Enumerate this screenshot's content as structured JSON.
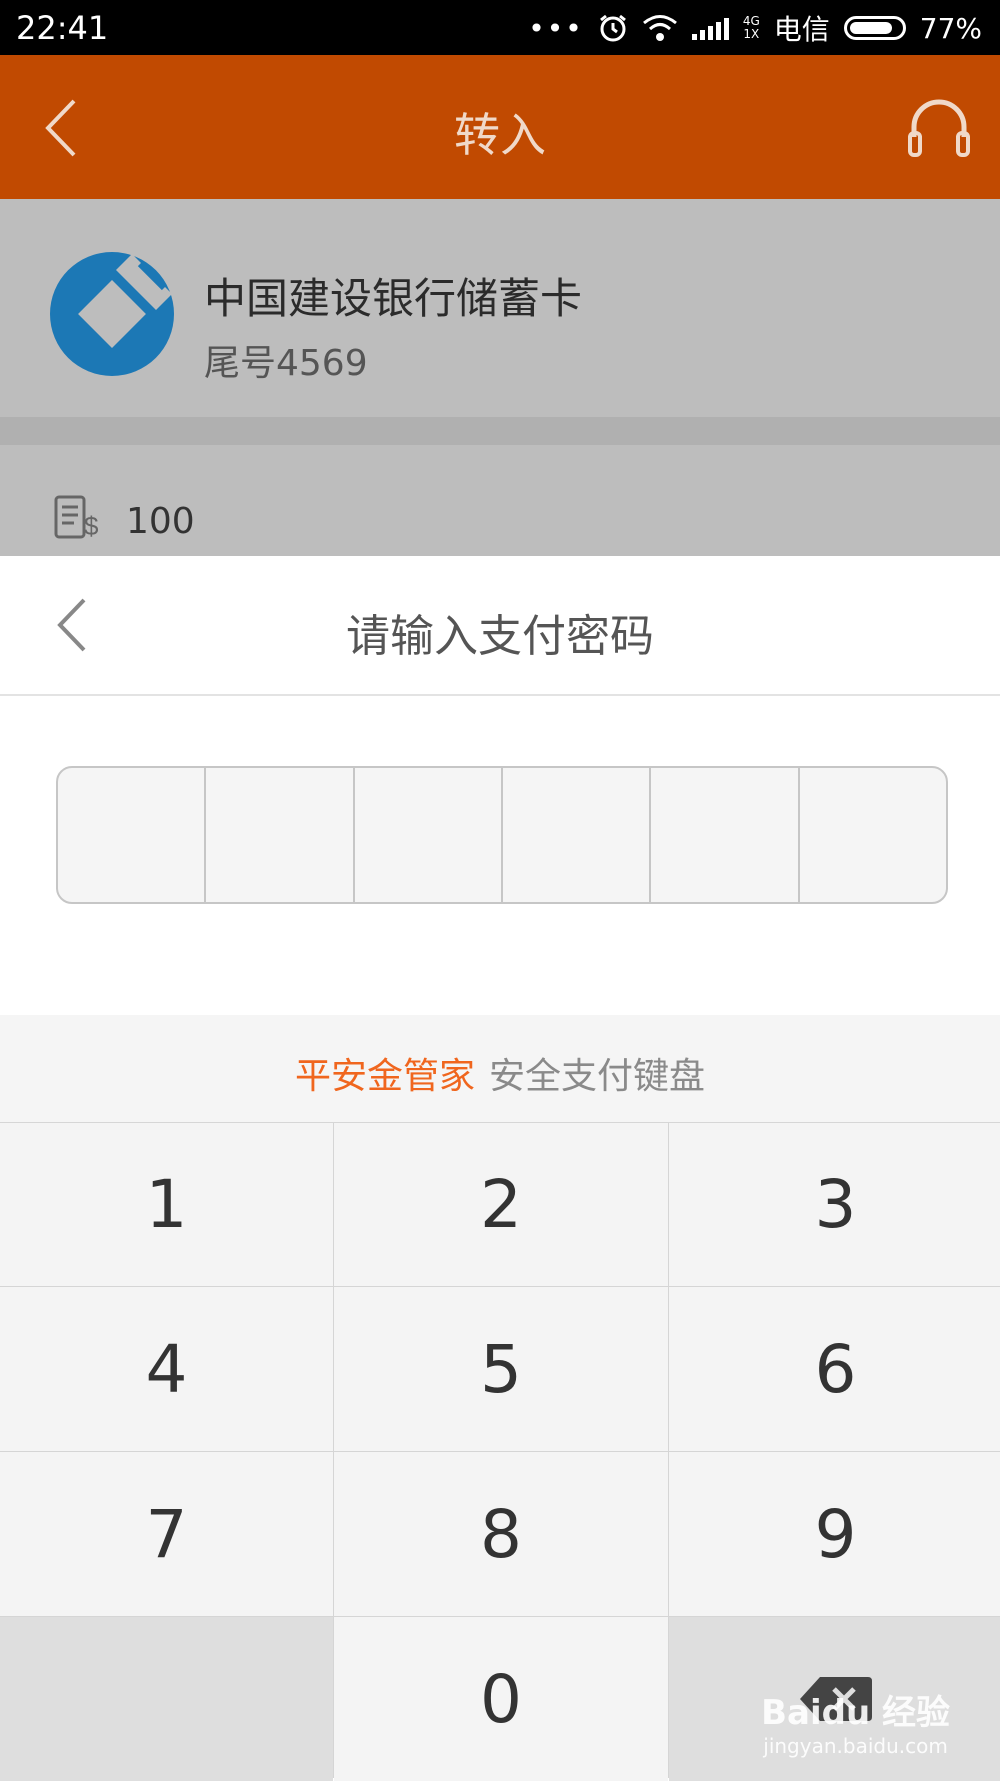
{
  "status_bar": {
    "time": "22:41",
    "network_top": "4G",
    "network_bottom": "1X",
    "carrier": "电信",
    "battery": "77%",
    "battery_level": 0.77
  },
  "header": {
    "title": "转入",
    "back_icon": "chevron-left-icon",
    "support_icon": "headset-icon"
  },
  "card": {
    "bank_name": "中国建设银行储蓄卡",
    "tail": "尾号4569",
    "logo_icon": "ccb-bank-logo",
    "logo_color": "#1c78b5"
  },
  "amount": {
    "icon": "bill-dollar-icon",
    "value": "100"
  },
  "password": {
    "title": "请输入支付密码",
    "digits": 6
  },
  "keyboard": {
    "brand": "平安金管家",
    "subtitle": "安全支付键盘",
    "keys": [
      "1",
      "2",
      "3",
      "4",
      "5",
      "6",
      "7",
      "8",
      "9",
      "",
      "0",
      ""
    ],
    "delete_icon": "backspace-icon"
  },
  "watermark": {
    "main": "Baidu 经验",
    "sub": "jingyan.baidu.com"
  },
  "colors": {
    "header_bg": "#c14a01",
    "brand_orange": "#f0661e",
    "dim_overlay": "#bdbdbd"
  }
}
